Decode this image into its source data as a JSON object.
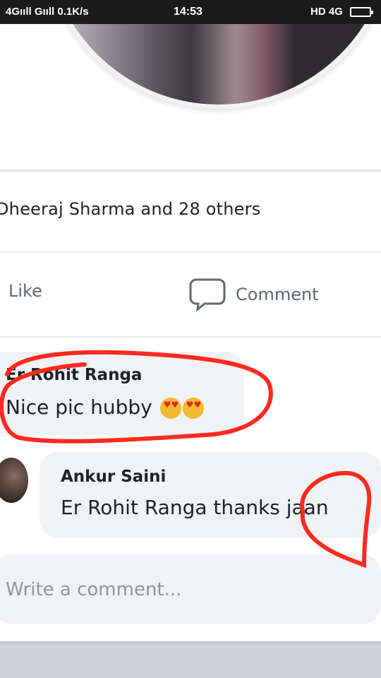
{
  "status_bar": {
    "network_left": "4Gııll Gııll",
    "speed": "0.1K/s",
    "time": "14:53",
    "network_right": "HD 4G",
    "battery": "battery-icon"
  },
  "post": {
    "likes_text": "Dheeraj Sharma and 28 others",
    "like_label": "Like",
    "comment_label": "Comment"
  },
  "comments": [
    {
      "author": "Er Rohit Ranga",
      "text": "Nice pic hubby",
      "emoji": "heart-eyes-emoji"
    },
    {
      "author": "Ankur Saini",
      "text": "Er Rohit Ranga thanks jaan"
    }
  ],
  "composer": {
    "placeholder": "Write a comment..."
  },
  "annotation_color": "#ff2a1f"
}
